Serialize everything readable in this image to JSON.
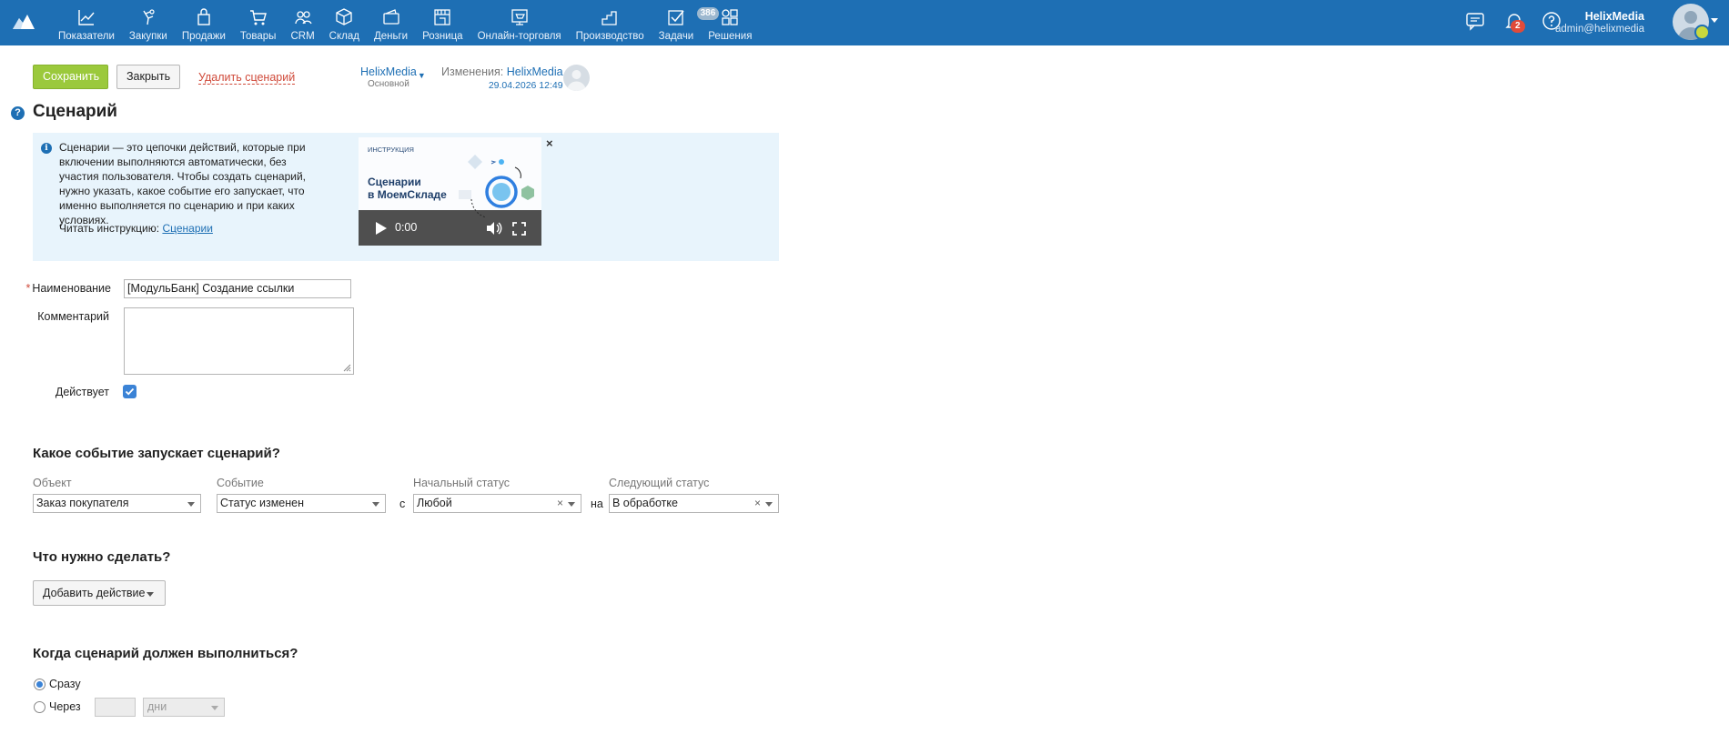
{
  "nav": {
    "items": [
      {
        "label": "Показатели",
        "icon": "chart-line-icon"
      },
      {
        "label": "Закупки",
        "icon": "purchase-hand-icon"
      },
      {
        "label": "Продажи",
        "icon": "shopping-bag-icon"
      },
      {
        "label": "Товары",
        "icon": "cart-icon"
      },
      {
        "label": "CRM",
        "icon": "people-icon"
      },
      {
        "label": "Склад",
        "icon": "box-icon"
      },
      {
        "label": "Деньги",
        "icon": "wallet-icon"
      },
      {
        "label": "Розница",
        "icon": "store-icon"
      },
      {
        "label": "Онлайн-торговля",
        "icon": "online-store-icon"
      },
      {
        "label": "Производство",
        "icon": "factory-icon"
      },
      {
        "label": "Задачи",
        "icon": "tasks-check-icon",
        "badge": "386"
      },
      {
        "label": "Решения",
        "icon": "apps-grid-icon"
      }
    ],
    "notifications_count": "2",
    "user": {
      "name": "HelixMedia",
      "email": "admin@helixmedia"
    }
  },
  "toolbar": {
    "save": "Сохранить",
    "close": "Закрыть",
    "delete": "Удалить сценарий",
    "org_name": "HelixMedia",
    "org_sub": "Основной",
    "changes_label": "Изменения:",
    "changes_user": "HelixMedia",
    "changes_date": "29.04.2026 12:49"
  },
  "page": {
    "title": "Сценарий",
    "help": "?"
  },
  "info": {
    "text": "Сценарии — это цепочки действий, которые при включении выполняются автоматически, без участия пользователя. Чтобы создать сценарий, нужно указать, какое событие его запускает, что именно выполняется по сценарию и при каких условиях.",
    "read_label": "Читать инструкцию:",
    "read_link": "Сценарии",
    "video_tag": "ИНСТРУКЦИЯ",
    "video_title_1": "Сценарии",
    "video_title_2": "в МоемСкладе",
    "video_time": "0:00"
  },
  "form": {
    "name_label": "Наименование",
    "name_value": "[МодульБанк] Создание ссылки",
    "comment_label": "Комментарий",
    "active_label": "Действует",
    "active": true
  },
  "trigger": {
    "title": "Какое событие запускает сценарий?",
    "object_label": "Объект",
    "object_value": "Заказ покупателя",
    "event_label": "Событие",
    "event_value": "Статус изменен",
    "from_label": "Начальный статус",
    "from_value": "Любой",
    "to_label": "Следующий статус",
    "to_value": "В обработке",
    "conn_from": "с",
    "conn_to": "на"
  },
  "actions": {
    "title": "Что нужно сделать?",
    "add": "Добавить действие"
  },
  "timing": {
    "title": "Когда сценарий должен выполниться?",
    "immediately": "Сразу",
    "after": "Через",
    "unit": "дни",
    "selected": "immediately"
  },
  "colors": {
    "topbar": "#1e6fb4",
    "save": "#9bc93c",
    "delete": "#d04a3a",
    "link": "#1e6fb4",
    "info_bg": "#e8f4fc"
  }
}
